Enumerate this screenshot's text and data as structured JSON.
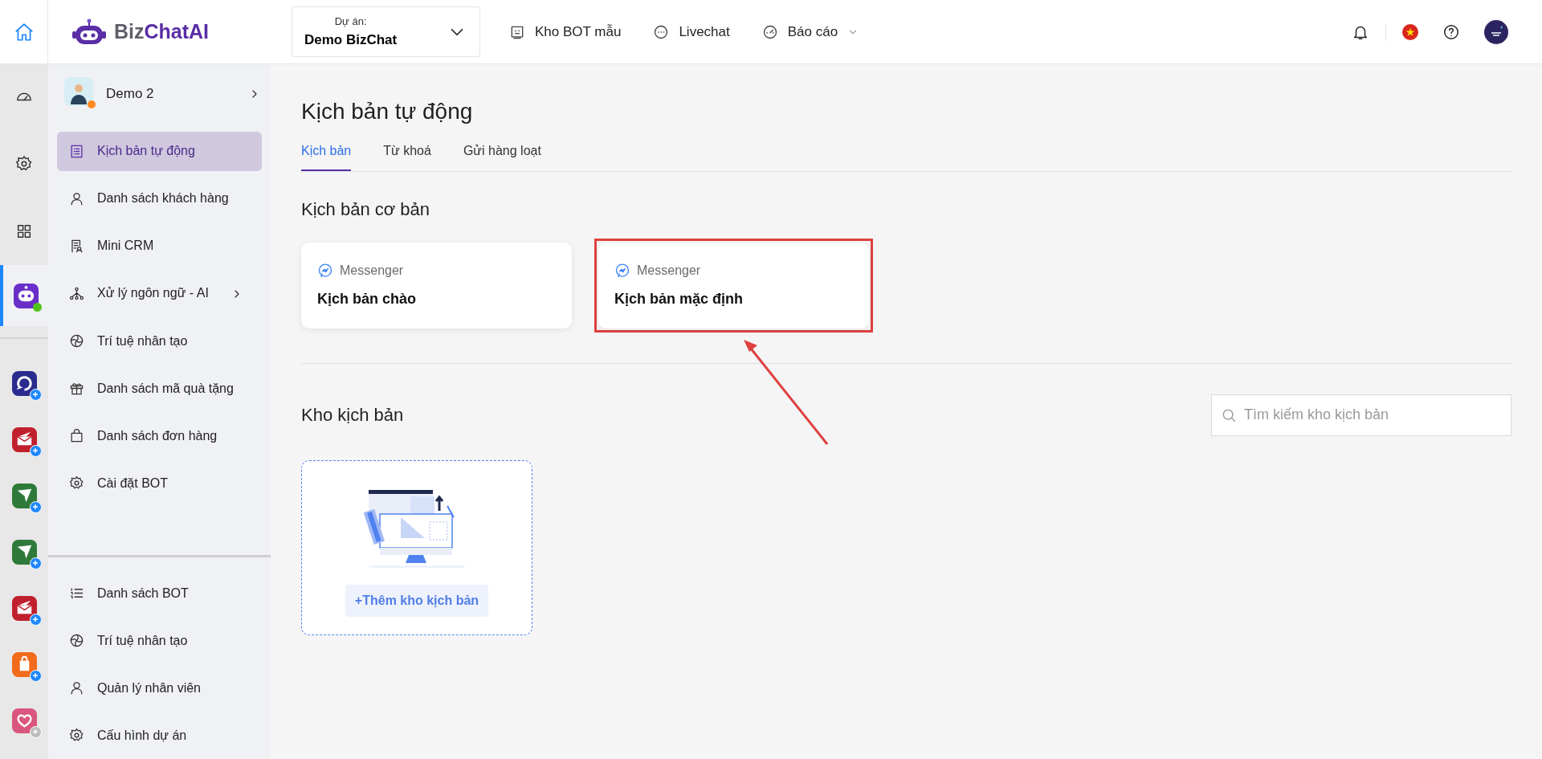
{
  "topbar": {
    "logo": {
      "prefix": "Biz",
      "suffix": "ChatAI"
    },
    "project": {
      "label": "Dự án:",
      "value": "Demo BizChat"
    },
    "nav": [
      {
        "label": "Kho BOT mẫu",
        "dropdown": false
      },
      {
        "label": "Livechat",
        "dropdown": false
      },
      {
        "label": "Báo cáo",
        "dropdown": true
      }
    ]
  },
  "rail": {
    "apps": [
      {
        "color": "#6a2fc9",
        "selected": true,
        "disabled": false
      },
      {
        "color": "#2b2a8f",
        "selected": false,
        "disabled": false
      },
      {
        "color": "#c0202e",
        "selected": false,
        "disabled": false
      },
      {
        "color": "#2f7a3a",
        "selected": false,
        "disabled": false
      },
      {
        "color": "#2f7a3a",
        "selected": false,
        "disabled": false
      },
      {
        "color": "#c0202e",
        "selected": false,
        "disabled": false
      },
      {
        "color": "#f26a1b",
        "selected": false,
        "disabled": false
      },
      {
        "color": "#d9577f",
        "selected": false,
        "disabled": true
      }
    ]
  },
  "sidebar": {
    "project": {
      "name": "Demo 2"
    },
    "items": [
      {
        "label": "Kịch bản tự động",
        "selected": true,
        "submenu": false
      },
      {
        "label": "Danh sách khách hàng",
        "selected": false,
        "submenu": false
      },
      {
        "label": "Mini CRM",
        "selected": false,
        "submenu": false
      },
      {
        "label": "Xử lý ngôn ngữ - AI",
        "selected": false,
        "submenu": true
      },
      {
        "label": "Trí tuệ nhân tạo",
        "selected": false,
        "submenu": false
      },
      {
        "label": "Danh sách mã quà tặng",
        "selected": false,
        "submenu": false
      },
      {
        "label": "Danh sách đơn hàng",
        "selected": false,
        "submenu": false
      },
      {
        "label": "Cài đặt BOT",
        "selected": false,
        "submenu": false
      }
    ],
    "bottom_items": [
      {
        "label": "Danh sách BOT",
        "selected": false,
        "submenu": false
      },
      {
        "label": "Trí tuệ nhân tạo",
        "selected": false,
        "submenu": false
      },
      {
        "label": "Quản lý nhân viên",
        "selected": false,
        "submenu": false
      },
      {
        "label": "Cấu hình dự án",
        "selected": false,
        "submenu": false
      }
    ]
  },
  "main": {
    "title": "Kịch bản tự động",
    "tabs": [
      {
        "label": "Kịch bản",
        "selected": true
      },
      {
        "label": "Từ khoá",
        "selected": false
      },
      {
        "label": "Gửi hàng loạt",
        "selected": false
      }
    ],
    "basic": {
      "title": "Kịch bản cơ bản",
      "cards": [
        {
          "channel": "Messenger",
          "title": "Kịch bản chào",
          "highlighted": false
        },
        {
          "channel": "Messenger",
          "title": "Kịch bản mặc định",
          "highlighted": true
        }
      ]
    },
    "library": {
      "title": "Kho kịch bản",
      "search": {
        "placeholder": "Tìm kiếm kho kịch bản"
      },
      "add_button": "+Thêm kho kịch bản"
    }
  }
}
